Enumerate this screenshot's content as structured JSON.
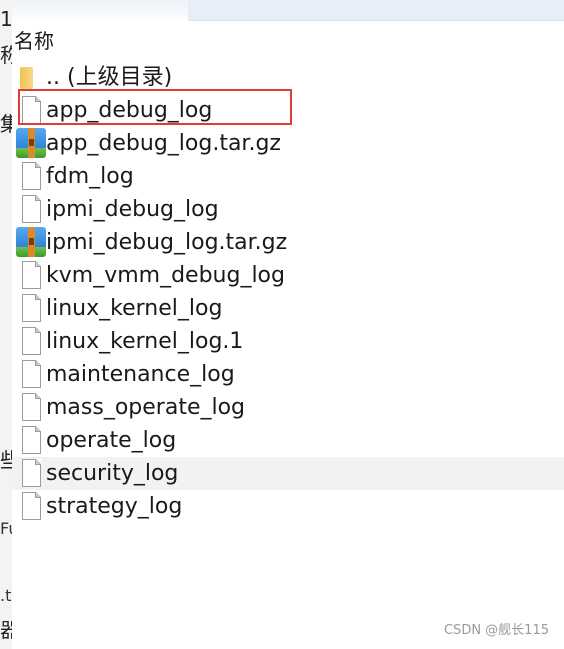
{
  "background_window": {
    "fragments": [
      "1",
      "称",
      "集",
      "些",
      "Fu",
      ".t",
      "器"
    ]
  },
  "column_header": "名称",
  "files": [
    {
      "name": ".. (上级目录)",
      "icon": "parent-folder-icon",
      "type": "folder"
    },
    {
      "name": "app_debug_log",
      "icon": "file-icon",
      "type": "file"
    },
    {
      "name": "app_debug_log.tar.gz",
      "icon": "archive-icon",
      "type": "archive"
    },
    {
      "name": "fdm_log",
      "icon": "file-icon",
      "type": "file"
    },
    {
      "name": "ipmi_debug_log",
      "icon": "file-icon",
      "type": "file"
    },
    {
      "name": "ipmi_debug_log.tar.gz",
      "icon": "archive-icon",
      "type": "archive"
    },
    {
      "name": "kvm_vmm_debug_log",
      "icon": "file-icon",
      "type": "file"
    },
    {
      "name": "linux_kernel_log",
      "icon": "file-icon",
      "type": "file"
    },
    {
      "name": "linux_kernel_log.1",
      "icon": "file-icon",
      "type": "file"
    },
    {
      "name": "maintenance_log",
      "icon": "file-icon",
      "type": "file"
    },
    {
      "name": "mass_operate_log",
      "icon": "file-icon",
      "type": "file"
    },
    {
      "name": "operate_log",
      "icon": "file-icon",
      "type": "file"
    },
    {
      "name": "security_log",
      "icon": "file-icon",
      "type": "file"
    },
    {
      "name": "strategy_log",
      "icon": "file-icon",
      "type": "file"
    }
  ],
  "hovered_file": "security_log",
  "highlighted_file": "app_debug_log",
  "colors": {
    "highlight_border": "#e03a3a",
    "hover_row": "#f2f2f2",
    "archive_blue": "#3a8fe0",
    "archive_green": "#4caf35",
    "archive_strap": "#d98a2b",
    "folder_yellow": "#f0c253"
  },
  "watermark": "CSDN @舰长115"
}
